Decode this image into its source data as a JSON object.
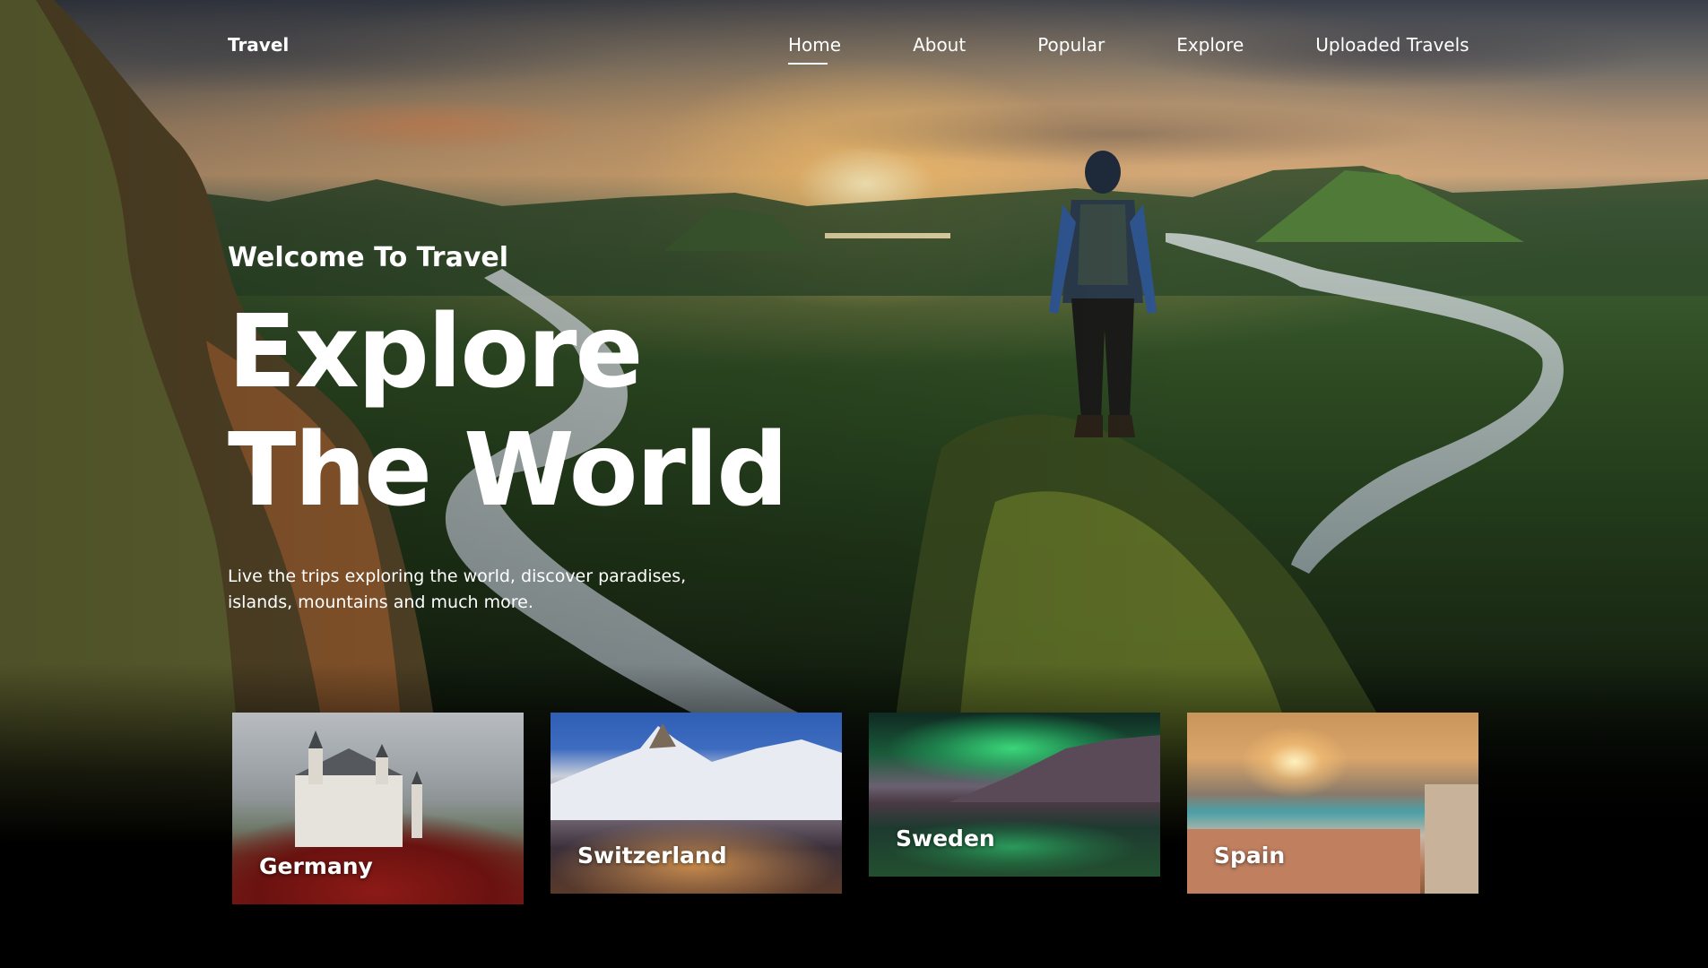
{
  "nav": {
    "logo": "Travel",
    "links": [
      {
        "label": "Home",
        "active": true
      },
      {
        "label": "About",
        "active": false
      },
      {
        "label": "Popular",
        "active": false
      },
      {
        "label": "Explore",
        "active": false
      },
      {
        "label": "Uploaded Travels",
        "active": false
      }
    ]
  },
  "hero": {
    "welcome": "Welcome To Travel",
    "headline_line1": "Explore",
    "headline_line2": "The World",
    "subtitle": "Live the trips exploring the world, discover paradises, islands, mountains and much more."
  },
  "destinations": [
    {
      "name": "Germany"
    },
    {
      "name": "Switzerland"
    },
    {
      "name": "Sweden"
    },
    {
      "name": "Spain"
    }
  ]
}
